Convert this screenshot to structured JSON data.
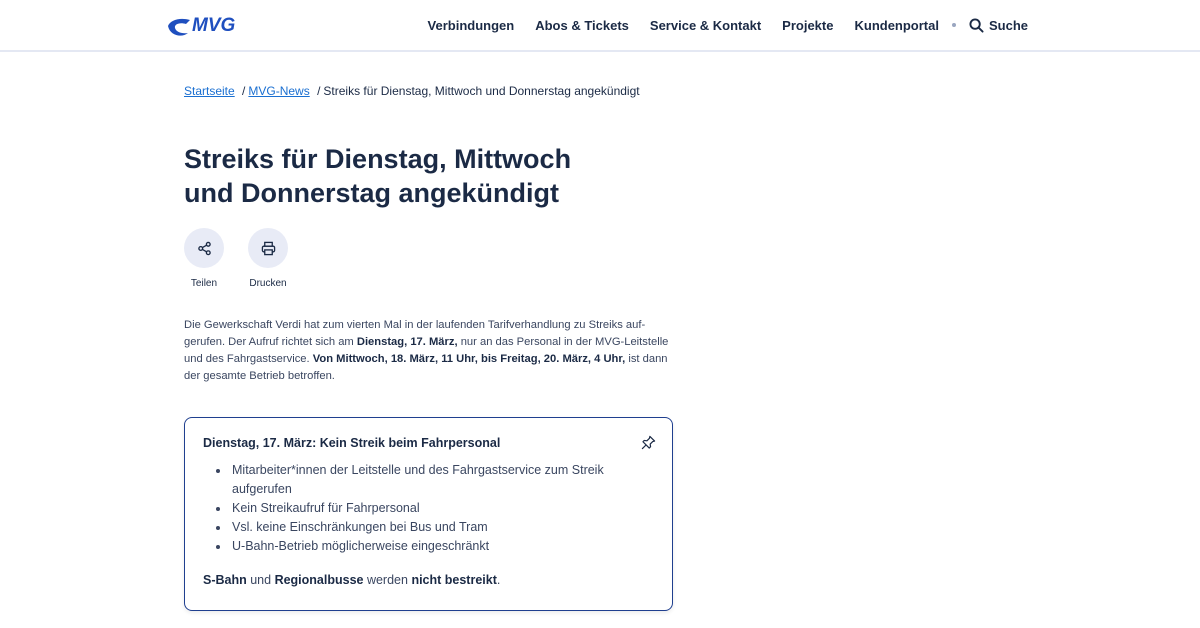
{
  "header": {
    "logo_text": "MVG",
    "nav": [
      "Verbindungen",
      "Abos & Tickets",
      "Service & Kontakt",
      "Projekte",
      "Kundenportal"
    ],
    "search_label": "Suche"
  },
  "breadcrumb": {
    "home": "Startseite",
    "news": "MVG-News",
    "current": "Streiks für Dienstag, Mittwoch und Donnerstag angekündigt",
    "separator": "/"
  },
  "article": {
    "title": "Streiks für Dienstag, Mittwoch und Donnerstag angekündigt",
    "share_label": "Teilen",
    "print_label": "Drucken",
    "intro": {
      "p1": "Die Gewerkschaft Verdi hat zum vierten Mal in der laufenden Tarifverhandlung zu Streiks auf­gerufen. Der Aufruf richtet sich am ",
      "b1": "Dienstag, 17. März,",
      "p2": " nur an das Personal in der MVG-Leit­stelle und des Fahrgastservice. ",
      "b2": "Von Mittwoch, 18. März, 11 Uhr, bis Freitag, 20. März, 4 Uhr,",
      "p3": " ist dann der gesamte Betrieb betroffen."
    }
  },
  "card": {
    "title": "Dienstag, 17. März: Kein Streik beim Fahrpersonal",
    "items": [
      "Mitarbeiter*innen der Leitstelle und des Fahrgastservice zum Streik aufgerufen",
      "Kein Streikaufruf für Fahrpersonal",
      "Vsl. keine Einschränkungen bei Bus und Tram",
      "U-Bahn-Betrieb möglicherweise eingeschränkt"
    ],
    "note": {
      "b1": "S-Bahn",
      "t1": " und ",
      "b2": "Regionalbusse",
      "t2": " werden ",
      "b3": "nicht bestreikt",
      "t3": "."
    }
  },
  "colors": {
    "brand_blue": "#1f4fbf",
    "text_dark": "#1b2a45",
    "link": "#1a6fd1",
    "card_border": "#1f3f8f",
    "action_bg": "#e8ebf6"
  }
}
